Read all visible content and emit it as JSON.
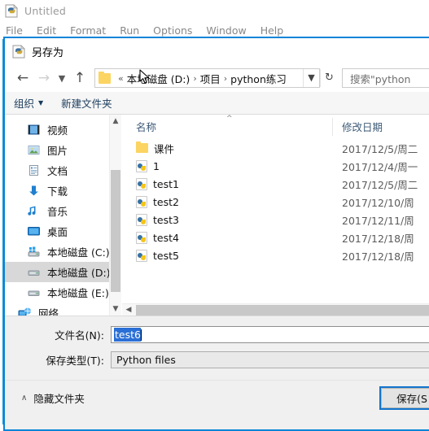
{
  "idle": {
    "title": "Untitled",
    "icon": "python-idle-icon",
    "menu": [
      "File",
      "Edit",
      "Format",
      "Run",
      "Options",
      "Window",
      "Help"
    ]
  },
  "dialog": {
    "title": "另存为",
    "icon": "python-idle-icon",
    "nav": {
      "back_icon": "arrow-left-icon",
      "forward_icon": "arrow-right-icon",
      "recent_icon": "chevron-down-icon",
      "up_icon": "arrow-up-icon",
      "dropdown_icon": "chevron-down-icon",
      "refresh_icon": "refresh-icon"
    },
    "breadcrumb": {
      "folder_icon": "folder-icon",
      "overflow": "«",
      "segments": [
        "本地磁盘 (D:)",
        "项目",
        "python练习"
      ],
      "separator": "›"
    },
    "search": {
      "text": "搜索\"python"
    },
    "toolbar": {
      "organize": "组织",
      "organize_caret": "▼",
      "new_folder": "新建文件夹"
    },
    "sidebar": {
      "items": [
        {
          "label": "视频",
          "icon": "video-icon",
          "selected": false,
          "root": false
        },
        {
          "label": "图片",
          "icon": "pictures-icon",
          "selected": false,
          "root": false
        },
        {
          "label": "文档",
          "icon": "documents-icon",
          "selected": false,
          "root": false
        },
        {
          "label": "下载",
          "icon": "downloads-icon",
          "selected": false,
          "root": false
        },
        {
          "label": "音乐",
          "icon": "music-icon",
          "selected": false,
          "root": false
        },
        {
          "label": "桌面",
          "icon": "desktop-icon",
          "selected": false,
          "root": false
        },
        {
          "label": "本地磁盘 (C:)",
          "icon": "windows-drive-icon",
          "selected": false,
          "root": false
        },
        {
          "label": "本地磁盘 (D:)",
          "icon": "drive-icon",
          "selected": true,
          "root": false
        },
        {
          "label": "本地磁盘 (E:)",
          "icon": "drive-icon",
          "selected": false,
          "root": false
        },
        {
          "label": "网络",
          "icon": "network-icon",
          "selected": false,
          "root": true
        }
      ],
      "scroll_up_icon": "chevron-up-icon",
      "scroll_down_icon": "chevron-down-icon"
    },
    "filelist": {
      "columns": {
        "name": "名称",
        "date": "修改日期"
      },
      "sort_indicator": "^",
      "rows": [
        {
          "name": "课件",
          "icon": "folder-icon",
          "date": "2017/12/5/周二"
        },
        {
          "name": "1",
          "icon": "python-file-icon",
          "date": "2017/12/4/周一"
        },
        {
          "name": "test1",
          "icon": "python-file-icon",
          "date": "2017/12/5/周二"
        },
        {
          "name": "test2",
          "icon": "python-file-icon",
          "date": "2017/12/10/周"
        },
        {
          "name": "test3",
          "icon": "python-file-icon",
          "date": "2017/12/11/周"
        },
        {
          "name": "test4",
          "icon": "python-file-icon",
          "date": "2017/12/18/周"
        },
        {
          "name": "test5",
          "icon": "python-file-icon",
          "date": "2017/12/18/周"
        }
      ],
      "hscroll_left_icon": "chevron-left-icon"
    },
    "form": {
      "filename_label": "文件名(N):",
      "filename_value": "test6",
      "filetype_label": "保存类型(T):",
      "filetype_value": "Python files"
    },
    "footer": {
      "hide_folders_caret": "∧",
      "hide_folders_label": "隐藏文件夹",
      "save_label": "保存(S"
    }
  },
  "colors": {
    "accent_blue": "#0a84d8",
    "selection_blue": "#2a6fd6",
    "sidebar_selected": "#d8d8d8",
    "header_text": "#3d5a77",
    "folder_yellow": "#fcd462"
  }
}
